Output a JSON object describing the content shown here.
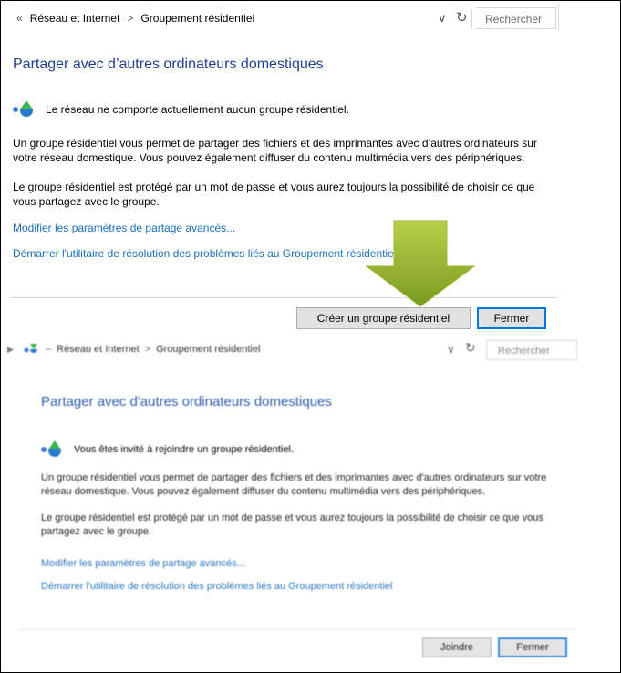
{
  "top": {
    "breadcrumb": {
      "back": "«",
      "item1": "Réseau et Internet",
      "separator": ">",
      "item2": "Groupement résidentiel"
    },
    "dropdown_icon": "chevron-down-icon",
    "refresh_icon": "refresh-icon",
    "search_placeholder": "Rechercher",
    "title": "Partager avec d’autres ordinateurs domestiques",
    "status": "Le réseau ne comporte actuellement aucun groupe résidentiel.",
    "paragraph1": "Un groupe résidentiel vous permet de partager des fichiers et des imprimantes avec d’autres ordinateurs sur votre réseau domestique. Vous pouvez également diffuser du contenu multimédia vers des périphériques.",
    "paragraph2": "Le groupe résidentiel est protégé par un mot de passe et vous aurez toujours la possibilité de choisir ce que vous partagez avec le groupe.",
    "link1": "Modifier les paramètres de partage avancés...",
    "link2": "Démarrer l'utilitaire de résolution des problèmes liés au Groupement résidentiel",
    "create_button": "Créer un groupe résidentiel",
    "close_button": "Fermer"
  },
  "bottom": {
    "breadcrumb": {
      "item1": "Réseau et Internet",
      "separator": ">",
      "item2": "Groupement résidentiel"
    },
    "search_placeholder": "Rechercher",
    "title": "Partager avec d'autres ordinateurs domestiques",
    "status": "Vous êtes invité à rejoindre un groupe résidentiel.",
    "paragraph1": "Un groupe résidentiel vous permet de partager des fichiers et des imprimantes avec d'autres ordinateurs sur votre réseau domestique. Vous pouvez également diffuser du contenu multimédia vers des périphériques.",
    "paragraph2": "Le groupe résidentiel est protégé par un mot de passe et vous aurez toujours la possibilité de choisir ce que vous partagez avec le groupe.",
    "link1": "Modifier les paramètres de partage avancés...",
    "link2": "Démarrer l'utilitaire de résolution des problèmes liés au Groupement résidentiel",
    "join_button": "Joindre",
    "close_button": "Fermer"
  },
  "colors": {
    "title": "#1f3f8f",
    "link": "#1a6fbb",
    "button_focus": "#0078d7",
    "arrow_green": "#8fb02a"
  }
}
